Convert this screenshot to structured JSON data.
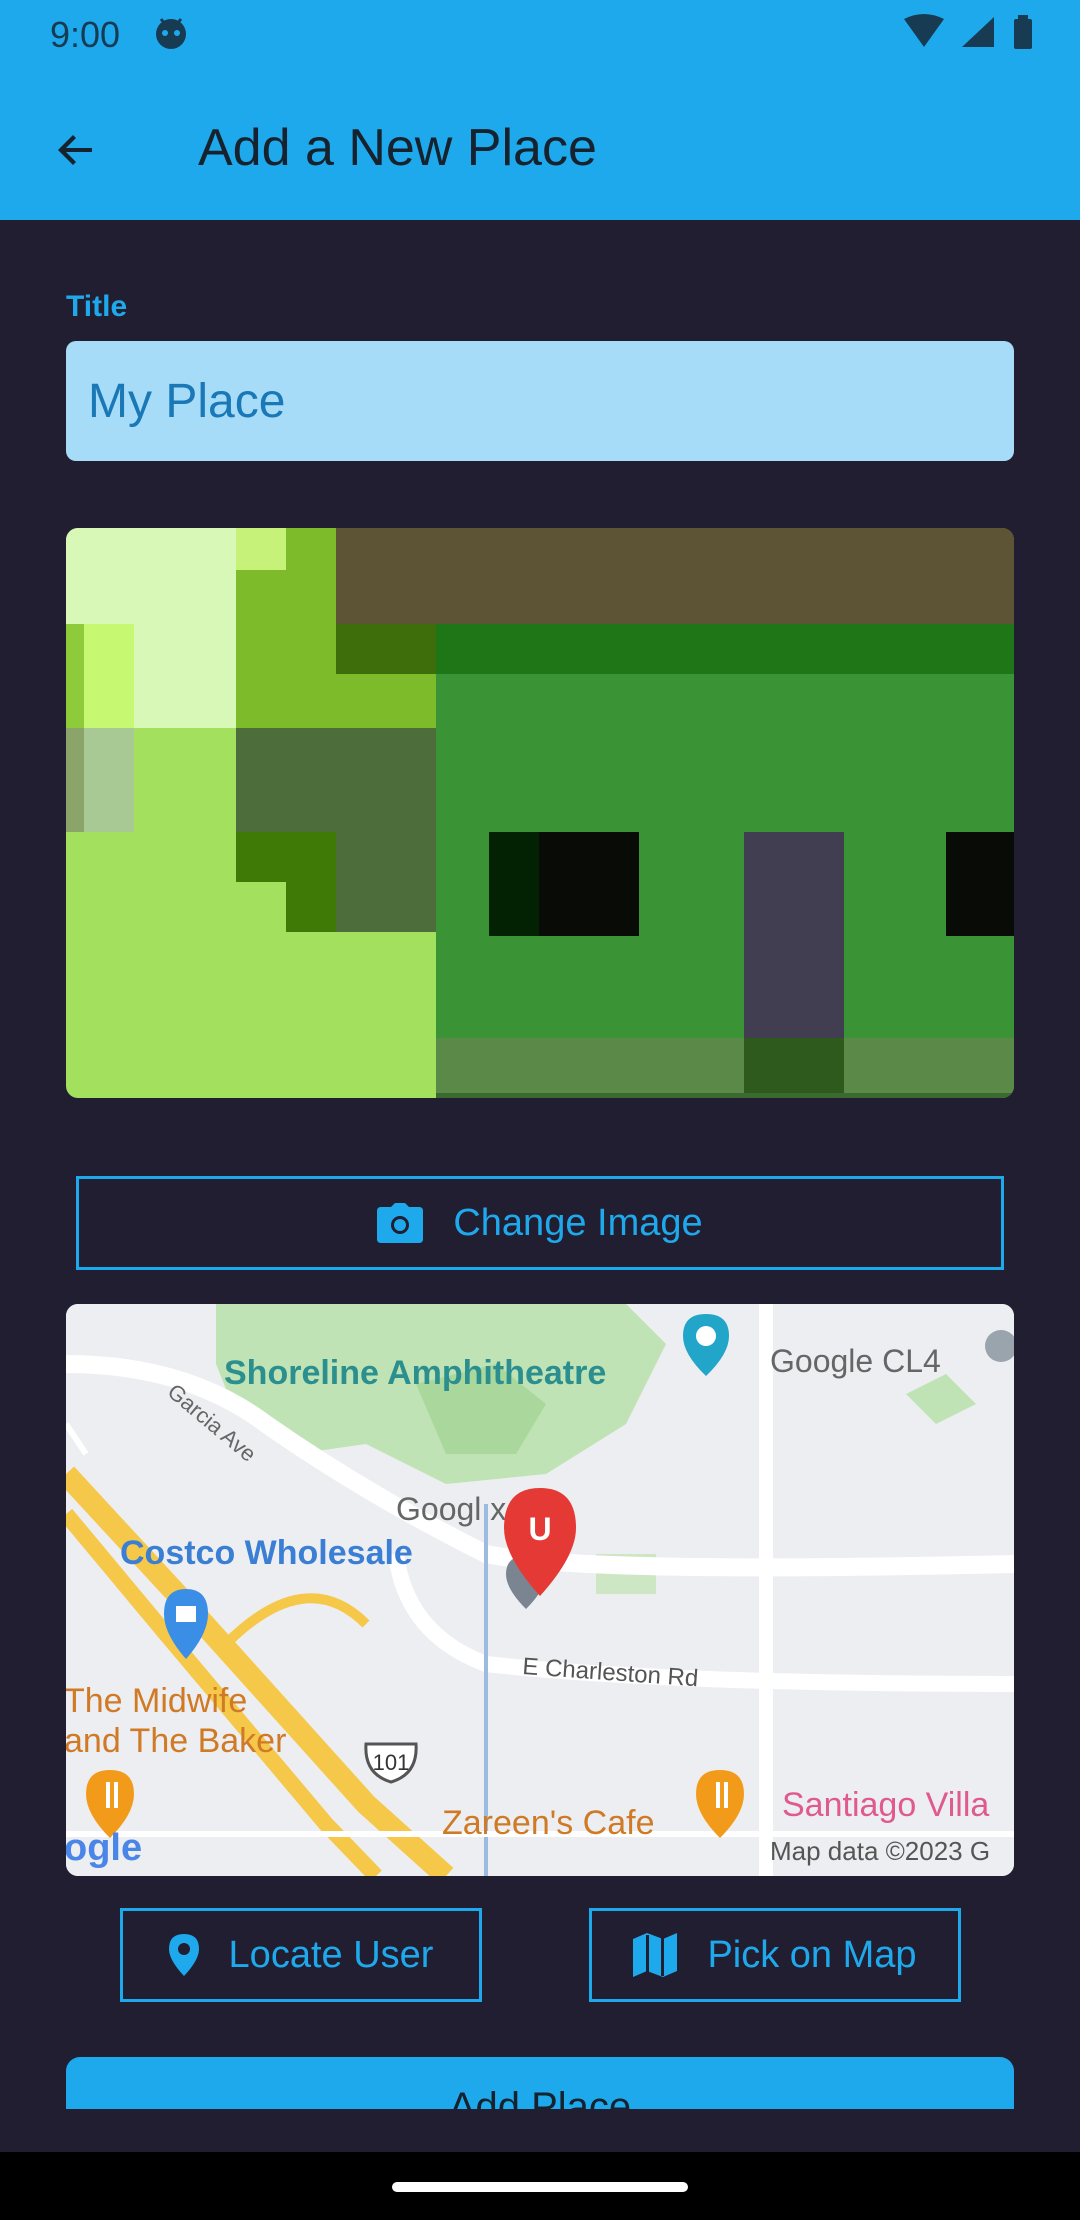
{
  "status_bar": {
    "time": "9:00"
  },
  "app_bar": {
    "title": "Add a New Place",
    "back_icon": "arrow-back-icon"
  },
  "form": {
    "title_label": "Title",
    "title_value": "My Place"
  },
  "buttons": {
    "change_image": "Change Image",
    "locate_user": "Locate User",
    "pick_on_map": "Pick on Map",
    "add_place": "Add Place"
  },
  "map": {
    "labels": {
      "shoreline": "Shoreline Amphitheatre",
      "google_cl4": "Google CL4",
      "garcia": "Garcia Ave",
      "googleplex": "Googl  x",
      "costco": "Costco Wholesale",
      "charleston": "E Charleston Rd",
      "midwife1": "The Midwife",
      "midwife2": "and The Baker",
      "highway": "101",
      "zareen": "Zareen's Cafe",
      "santiago": "Santiago Villa",
      "google_logo": "ogle",
      "map_data": "Map data ©2023 G",
      "marker_letter": "U"
    }
  },
  "colors": {
    "accent": "#1ea9ec",
    "background": "#221e31",
    "field": "#a6dcf8"
  }
}
